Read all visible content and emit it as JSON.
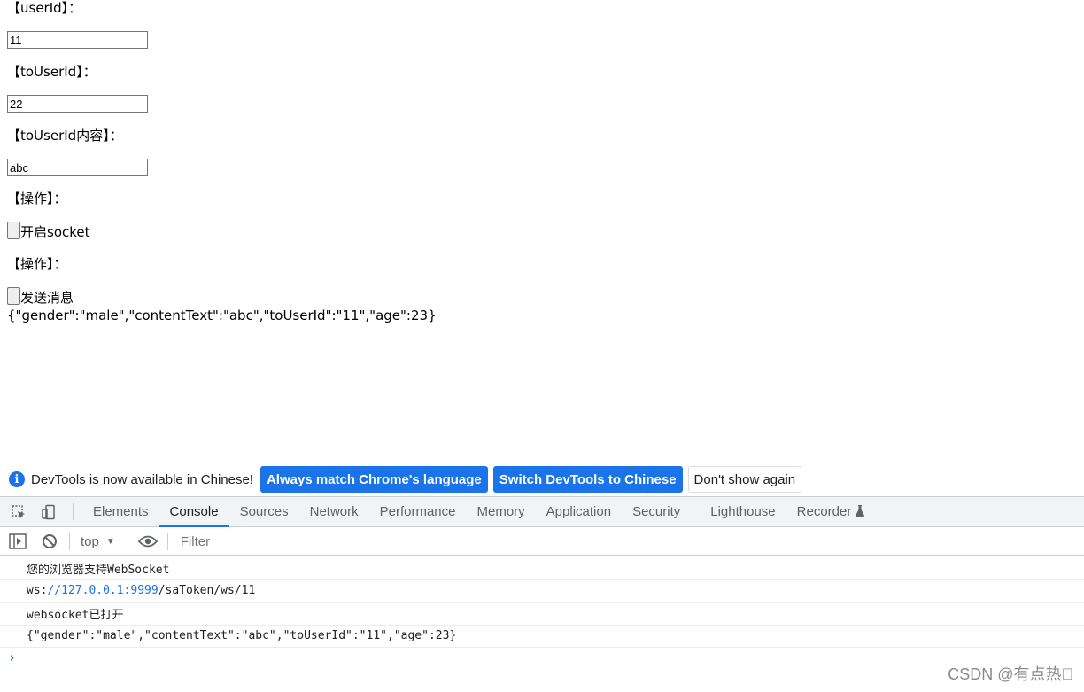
{
  "page": {
    "user_id_label": "【userId】：",
    "user_id_value": "11",
    "to_user_id_label": "【toUserId】：",
    "to_user_id_value": "22",
    "content_label": "【toUserId内容】：",
    "content_value": "abc",
    "op_label_1": "【操作】：",
    "open_socket_text": "开启socket",
    "op_label_2": "【操作】：",
    "send_message_text": "发送消息",
    "json_output": "{\"gender\":\"male\",\"contentText\":\"abc\",\"toUserId\":\"11\",\"age\":23}"
  },
  "infobar": {
    "message": "DevTools is now available in Chinese!",
    "btn_match": "Always match Chrome's language",
    "btn_switch": "Switch DevTools to Chinese",
    "btn_dont_show": "Don't show again"
  },
  "tabs": [
    "Elements",
    "Console",
    "Sources",
    "Network",
    "Performance",
    "Memory",
    "Application",
    "Security",
    "Lighthouse",
    "Recorder"
  ],
  "active_tab": "Console",
  "toolbar": {
    "context": "top",
    "filter_placeholder": "Filter"
  },
  "console": {
    "line1": "您的浏览器支持WebSocket",
    "line2_prefix": "ws:",
    "line2_link": "//127.0.0.1:9999",
    "line2_suffix": "/saToken/ws/11",
    "line3": "websocket已打开",
    "line4": "{\"gender\":\"male\",\"contentText\":\"abc\",\"toUserId\":\"11\",\"age\":23}",
    "prompt": "›"
  },
  "watermark": "CSDN @有点热\u0000",
  "colors": {
    "accent": "#1a73e8",
    "tab_bg": "#f1f3f4"
  }
}
